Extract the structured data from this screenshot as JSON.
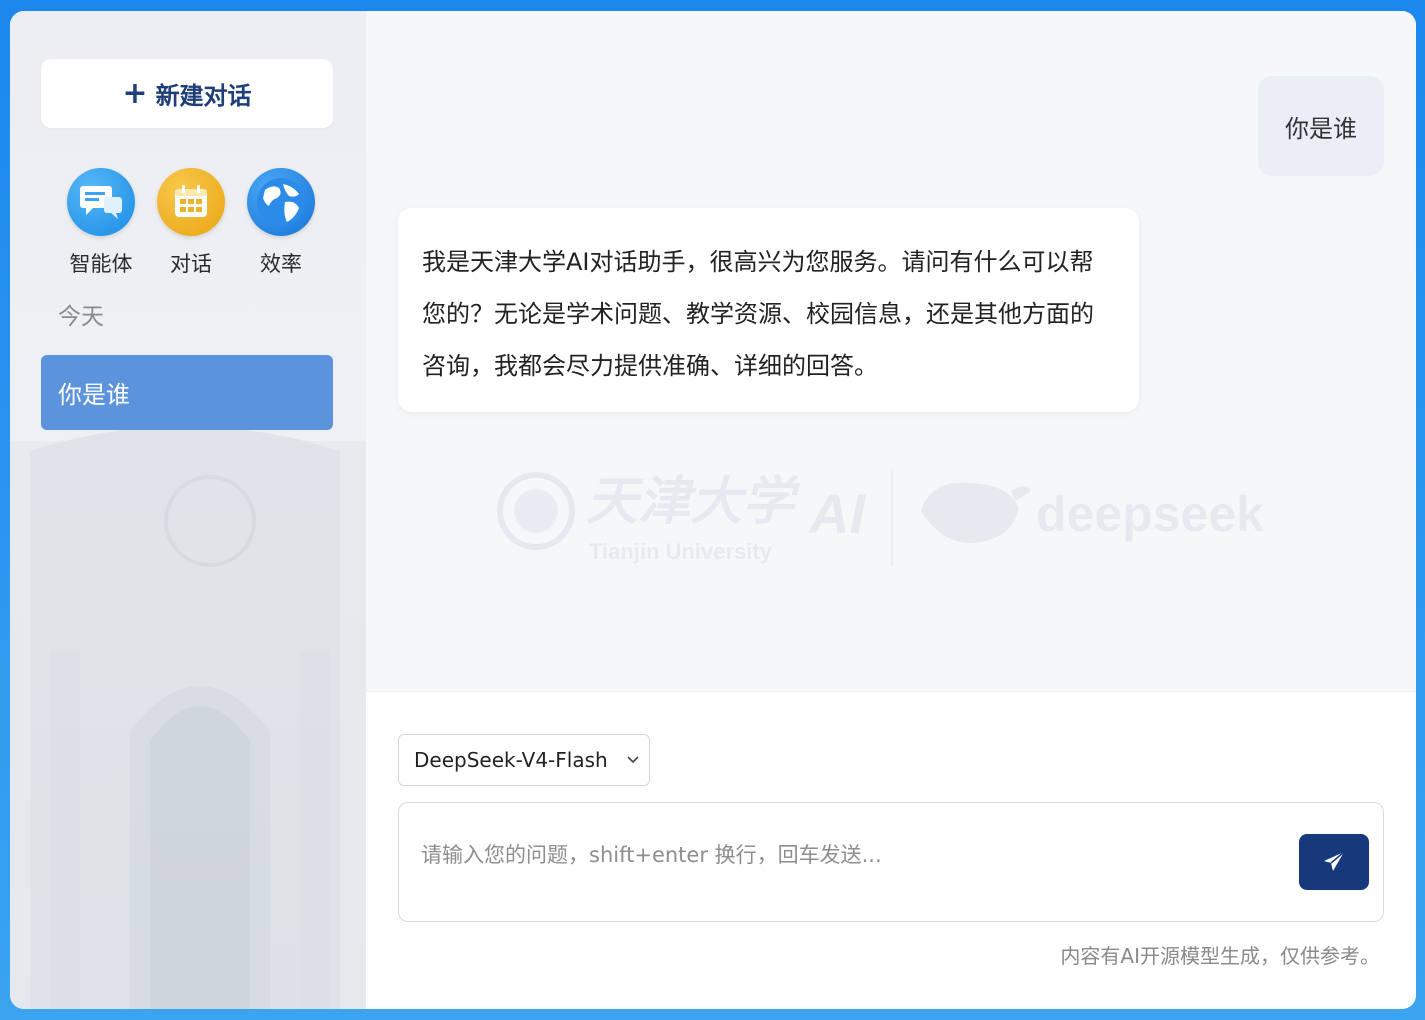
{
  "sidebar": {
    "new_chat_label": "新建对话",
    "apps": [
      {
        "label": "智能体",
        "icon": "chat-bubbles-icon"
      },
      {
        "label": "对话",
        "icon": "calendar-icon"
      },
      {
        "label": "效率",
        "icon": "globe-icon"
      }
    ],
    "section_today": "今天",
    "history": [
      {
        "title": "你是谁",
        "active": true
      }
    ]
  },
  "chat": {
    "messages": [
      {
        "role": "user",
        "text": "你是谁"
      },
      {
        "role": "assistant",
        "text": "我是天津大学AI对话助手，很高兴为您服务。请问有什么可以帮您的？无论是学术问题、教学资源、校园信息，还是其他方面的咨询，我都会尽力提供准确、详细的回答。"
      }
    ],
    "watermark": {
      "university_cn": "天津大学",
      "university_en": "Tianjin University",
      "ai_text": "AI",
      "partner": "deepseek"
    }
  },
  "input": {
    "model_selected": "DeepSeek-V4-Flash",
    "placeholder": "请输入您的问题，shift+enter 换行，回车发送...",
    "value": "",
    "send_icon": "paper-plane-icon",
    "disclaimer": "内容有AI开源模型生成，仅供参考。"
  },
  "colors": {
    "accent": "#15397a",
    "history_active": "#5b94dc",
    "frame": "#1c88ee"
  }
}
